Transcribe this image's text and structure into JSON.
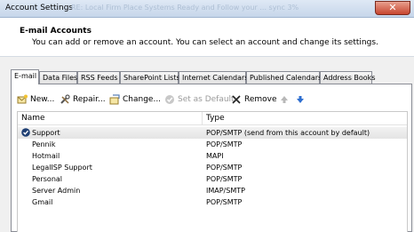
{
  "window": {
    "title": "Account Settings",
    "ghost_text": "  RE: Local Firm Place Systems          Ready and Follow your ... sync 3%"
  },
  "header": {
    "title": "E-mail Accounts",
    "subtitle": "You can add or remove an account. You can select an account and change its settings."
  },
  "tabs": [
    {
      "label": "E-mail",
      "active": true
    },
    {
      "label": "Data Files"
    },
    {
      "label": "RSS Feeds"
    },
    {
      "label": "SharePoint Lists"
    },
    {
      "label": "Internet Calendars"
    },
    {
      "label": "Published Calendars"
    },
    {
      "label": "Address Books"
    }
  ],
  "toolbar": {
    "new_label": "New...",
    "repair_label": "Repair...",
    "change_label": "Change...",
    "default_label": "Set as Default",
    "remove_label": "Remove"
  },
  "list": {
    "name_header": "Name",
    "type_header": "Type",
    "rows": [
      {
        "name": "Support",
        "type": "POP/SMTP (send from this account by default)",
        "default": true
      },
      {
        "name": "Pennik",
        "type": "POP/SMTP"
      },
      {
        "name": "Hotmail",
        "type": "MAPI"
      },
      {
        "name": "LegalISP Support",
        "type": "POP/SMTP"
      },
      {
        "name": "Personal",
        "type": "POP/SMTP"
      },
      {
        "name": "Server Admin",
        "type": "IMAP/SMTP"
      },
      {
        "name": "Gmail",
        "type": "POP/SMTP"
      }
    ]
  }
}
